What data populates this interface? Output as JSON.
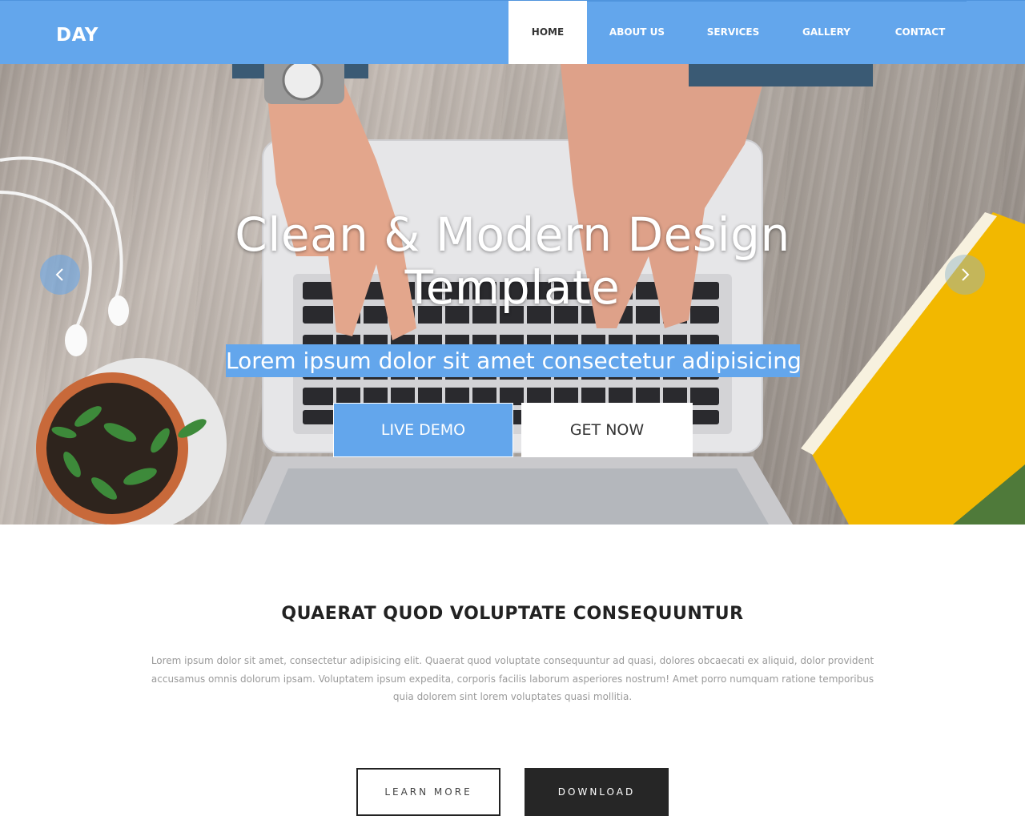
{
  "navbar": {
    "logo": "DAY",
    "items": [
      {
        "label": "HOME",
        "active": true
      },
      {
        "label": "ABOUT US",
        "active": false
      },
      {
        "label": "SERVICES",
        "active": false
      },
      {
        "label": "GALLERY",
        "active": false
      },
      {
        "label": "CONTACT",
        "active": false
      }
    ]
  },
  "hero": {
    "title": "Clean & Modern Design Template",
    "subtitle": "Lorem ipsum dolor sit amet consectetur adipisicing",
    "primary_button": "LIVE DEMO",
    "secondary_button": "GET NOW",
    "prev_icon": "chevron-left-icon",
    "next_icon": "chevron-right-icon"
  },
  "intro": {
    "title": "QUAERAT QUOD VOLUPTATE CONSEQUUNTUR",
    "text": "Lorem ipsum dolor sit amet, consectetur adipisicing elit. Quaerat quod voluptate consequuntur ad quasi, dolores obcaecati ex aliquid, dolor provident accusamus omnis dolorum ipsam. Voluptatem ipsum expedita, corporis facilis laborum asperiores nostrum! Amet porro numquam ratione temporibus quia dolorem sint lorem voluptates quasi mollitia.",
    "learn_button": "LEARN MORE",
    "download_button": "DOWNLOAD"
  },
  "colors": {
    "accent": "#63a6ec",
    "dark": "#262626",
    "heading": "#222222",
    "body_text": "#9a9a9a"
  }
}
